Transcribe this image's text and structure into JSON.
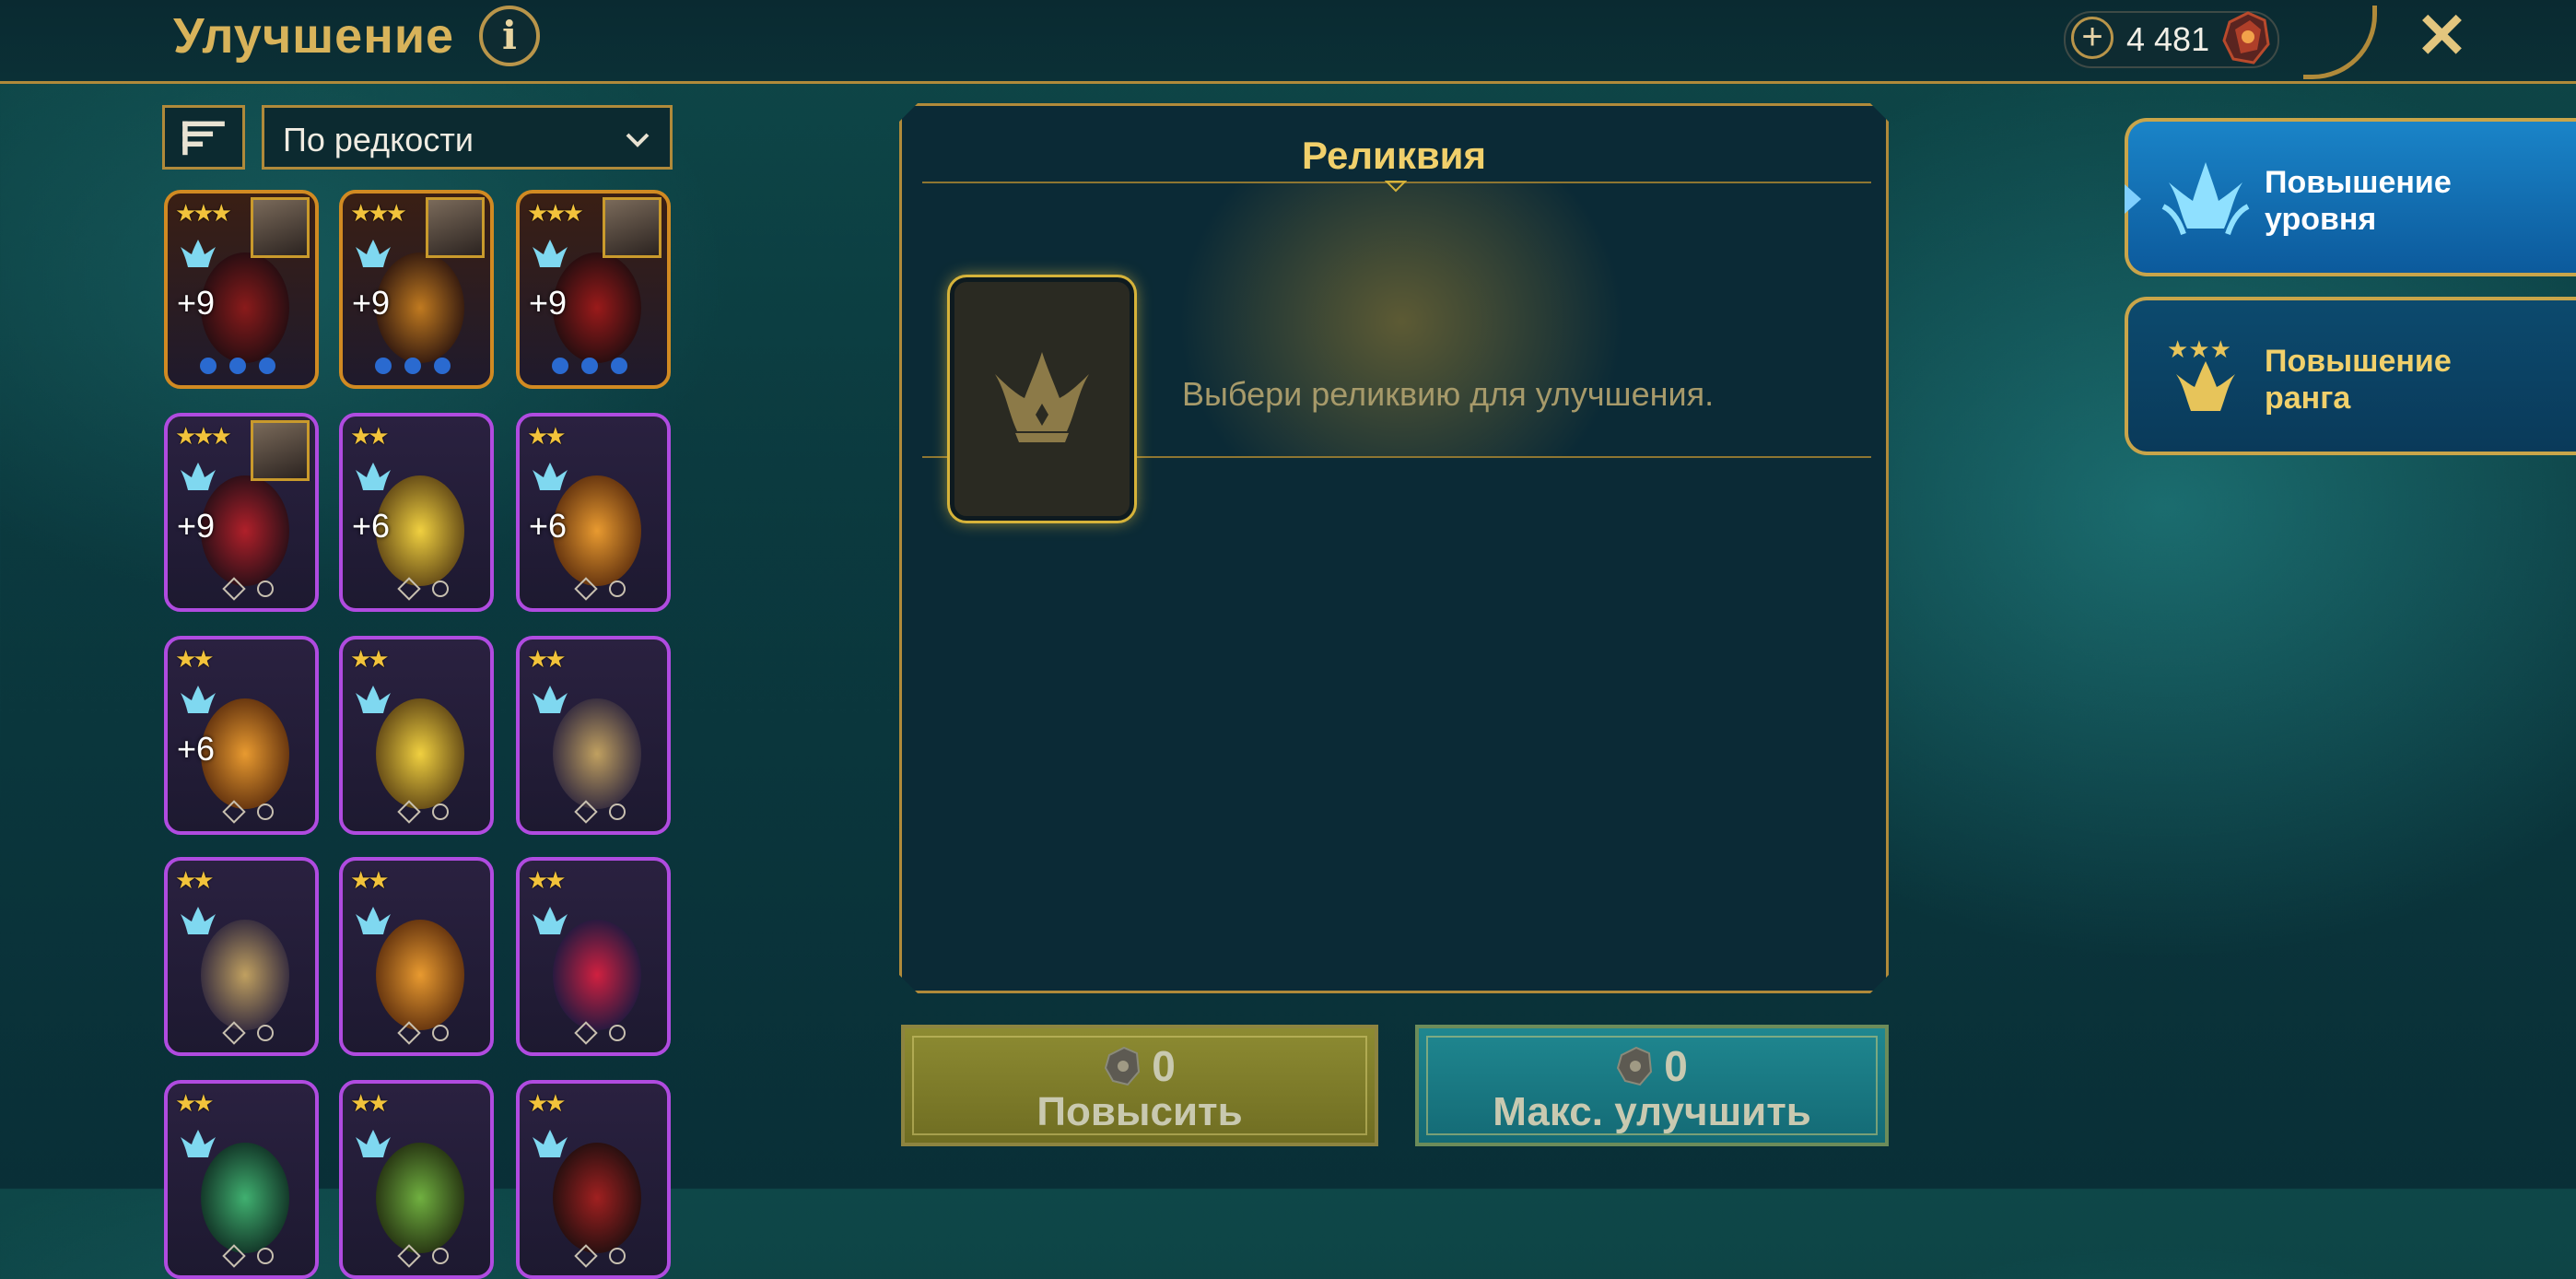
{
  "header": {
    "title": "Улучшение",
    "info_label": "i",
    "currency_plus": "+",
    "currency_amount": "4 481",
    "close_label": "✕"
  },
  "sort": {
    "dropdown_value": "По редкости"
  },
  "artifacts": [
    {
      "stars": "★★★",
      "level": "+9",
      "frame": "gold",
      "has_champion": true
    },
    {
      "stars": "★★★",
      "level": "+9",
      "frame": "gold",
      "has_champion": true
    },
    {
      "stars": "★★★",
      "level": "+9",
      "frame": "gold",
      "has_champion": true
    },
    {
      "stars": "★★★",
      "level": "+9",
      "frame": "purple",
      "has_champion": true
    },
    {
      "stars": "★★",
      "level": "+6",
      "frame": "purple",
      "has_champion": false
    },
    {
      "stars": "★★",
      "level": "+6",
      "frame": "purple",
      "has_champion": false
    },
    {
      "stars": "★★",
      "level": "+6",
      "frame": "purple",
      "has_champion": false
    },
    {
      "stars": "★★",
      "level": "",
      "frame": "purple",
      "has_champion": false
    },
    {
      "stars": "★★",
      "level": "",
      "frame": "purple",
      "has_champion": false
    },
    {
      "stars": "★★",
      "level": "",
      "frame": "purple",
      "has_champion": false
    },
    {
      "stars": "★★",
      "level": "",
      "frame": "purple",
      "has_champion": false
    },
    {
      "stars": "★★",
      "level": "",
      "frame": "purple",
      "has_champion": false
    },
    {
      "stars": "★★",
      "level": "",
      "frame": "purple",
      "has_champion": false
    },
    {
      "stars": "★★",
      "level": "",
      "frame": "purple",
      "has_champion": false
    },
    {
      "stars": "★★",
      "level": "",
      "frame": "purple",
      "has_champion": false
    }
  ],
  "relic_panel": {
    "title": "Реликвия",
    "hint": "Выбери реликвию для улучшения."
  },
  "actions": {
    "upgrade_cost": "0",
    "upgrade_label": "Повысить",
    "max_cost": "0",
    "max_label": "Макс. улучшить"
  },
  "tabs": {
    "level_line1": "Повышение",
    "level_line2": "уровня",
    "rank_line1": "Повышение",
    "rank_line2": "ранга"
  },
  "colors": {
    "gold_accent": "#b08a3a",
    "title_gold": "#d8b35a",
    "purple_frame": "#b04be0",
    "orange_frame": "#d18a22",
    "tab_blue": "#1a84c8"
  }
}
